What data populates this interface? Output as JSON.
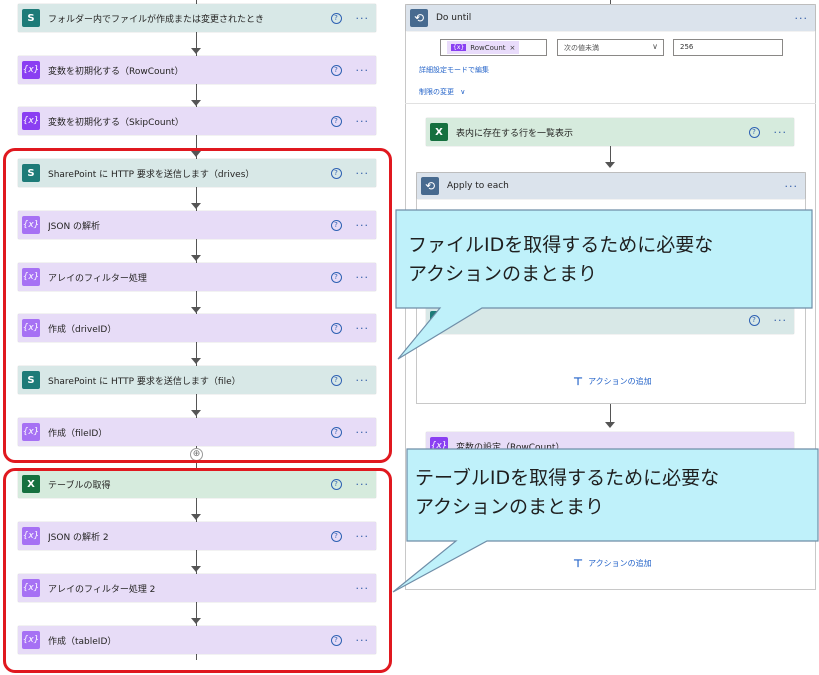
{
  "left_flow": {
    "trigger": "フォルダー内でファイルが作成または変更されたとき",
    "init_row": "変数を初期化する（RowCount）",
    "init_skip": "変数を初期化する（SkipCount）",
    "http_drives": "SharePoint に HTTP 要求を送信します（drives）",
    "parse_json": "JSON の解析",
    "filter_array": "アレイのフィルター処理",
    "compose_drive": "作成（driveID）",
    "http_file": "SharePoint に HTTP 要求を送信します（file）",
    "compose_file": "作成（fileID）",
    "get_table": "テーブルの取得",
    "parse_json2": "JSON の解析 2",
    "filter_array2": "アレイのフィルター処理 2",
    "compose_table": "作成（tableID）"
  },
  "right_flow": {
    "do_until": "Do until",
    "condition": {
      "token": "RowCount",
      "operator": "次の値未満",
      "value": "256"
    },
    "advanced_edit": "詳細設定モードで編集",
    "change_limits": "制限の変更",
    "list_rows": "表内に存在する行を一覧表示",
    "apply_each": "Apply to each",
    "add_action": "アクションの追加",
    "set_var": "変数の設定（RowCount）"
  },
  "callouts": {
    "file_id": [
      "ファイルIDを取得するために必要な",
      "アクションのまとまり"
    ],
    "table_id": [
      "テーブルIDを取得するために必要な",
      "アクションのまとまり"
    ]
  },
  "icons": {
    "help": "?",
    "more": "···",
    "var": "{x}",
    "excel": "X",
    "sharepoint": "S",
    "loop": "⟲",
    "add": "⊕",
    "close": "×",
    "chevron": "∨"
  }
}
